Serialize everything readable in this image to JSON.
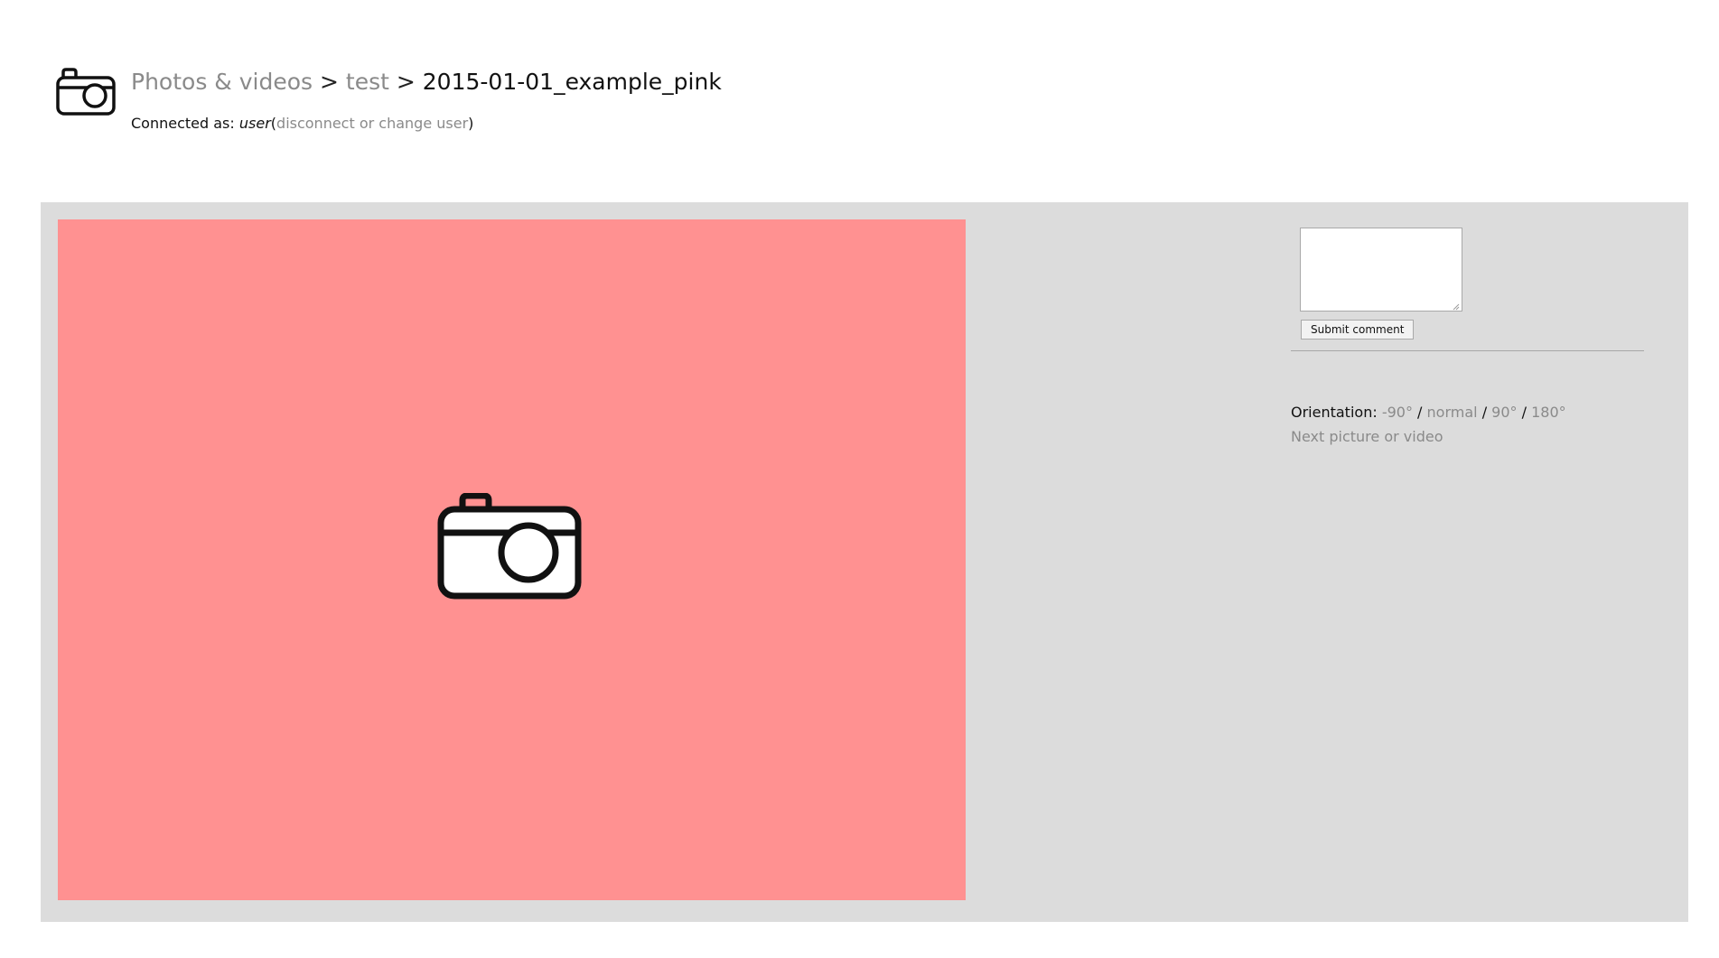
{
  "header": {
    "logo_icon": "camera-icon",
    "breadcrumb": {
      "root_label": "Photos & videos",
      "separator": ">",
      "album_label": "test",
      "current_label": "2015-01-01_example_pink"
    },
    "connected": {
      "prefix": "Connected as:",
      "username": "user",
      "open_paren": "(",
      "disconnect_label": "disconnect or change user",
      "close_paren": ")"
    }
  },
  "photo": {
    "background_color": "#ff9191",
    "placeholder_icon": "camera-icon"
  },
  "comments": {
    "input_value": "",
    "submit_label": "Submit comment"
  },
  "orientation": {
    "label": "Orientation:",
    "separator": "/",
    "options": [
      "-90°",
      "normal",
      "90°",
      "180°"
    ]
  },
  "navigation": {
    "next_label": "Next picture or video"
  },
  "colors": {
    "link": "#8a8a8a",
    "panel_background": "#dcdcdc",
    "photo_background": "#ff9191"
  }
}
